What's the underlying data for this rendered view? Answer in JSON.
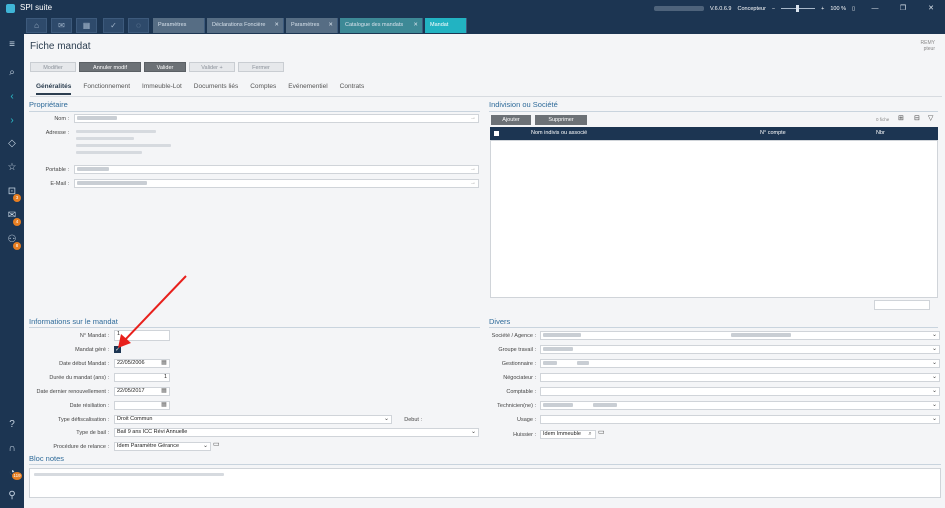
{
  "app": {
    "title": "SPI suite",
    "version": "V.6.0.6.9",
    "mode": "Concepteur",
    "zoom": "100 %"
  },
  "window_controls": [
    "—",
    "❐",
    "✕"
  ],
  "toolbar_icons": [
    "home-icon",
    "mail-icon",
    "calendar-icon",
    "check-icon",
    "bell-icon"
  ],
  "doc_tabs": [
    {
      "label": "Paramètres",
      "close": ""
    },
    {
      "label": "Déclarations Foncière",
      "close": "✕"
    },
    {
      "label": "Paramètres",
      "close": "✕"
    },
    {
      "label": "Catalogue des mandats",
      "close": "✕"
    },
    {
      "label": "Mandat",
      "close": ""
    }
  ],
  "sidebar_badges": [
    "3",
    "4",
    "8",
    "119"
  ],
  "page": {
    "title": "Fiche mandat",
    "user_line1": "REMY",
    "user_line2": "pteur"
  },
  "actions": {
    "modifier": "Modifier",
    "annuler": "Annuler modif",
    "valider": "Valider",
    "valider_plus": "Valider +",
    "fermer": "Fermer"
  },
  "tabs": [
    "Généralités",
    "Fonctionnement",
    "Immeuble-Lot",
    "Documents liés",
    "Comptes",
    "Evénementiel",
    "Contrats"
  ],
  "proprietaire": {
    "title": "Propriétaire",
    "nom_label": "Nom :",
    "adresse_label": "Adresse :",
    "portable_label": "Portable :",
    "email_label": "E-Mail :"
  },
  "indivision": {
    "title": "Indivision ou Société",
    "add": "Ajouter",
    "remove": "Supprimer",
    "count": "0 fiche",
    "columns": [
      "Nom indivis ou associé",
      "N° compte",
      "Nbr"
    ]
  },
  "mandat": {
    "title": "Informations sur le mandat",
    "numero_label": "N° Mandat :",
    "numero_value": "1",
    "gere_label": "Mandat géré :",
    "gere_checked": "✓",
    "debut_label": "Date début Mandat :",
    "debut_value": "22/05/2006",
    "duree_label": "Durée du mandat (ans) :",
    "duree_value": "1",
    "renouv_label": "Date dernier renouvellement :",
    "renouv_value": "22/05/2017",
    "resil_label": "Date résiliation :",
    "defisc_label": "Type défiscalisation :",
    "defisc_value": "Droit Commun",
    "defisc_debut_label": "Debut :",
    "bail_label": "Type de bail :",
    "bail_value": "Bail 9 ans ICC Révi Annuelle",
    "relance_label": "Procédure de relance :",
    "relance_value": "Idem Paramètre Gérance"
  },
  "divers": {
    "title": "Divers",
    "labels": [
      "Société / Agence :",
      "Groupe travail :",
      "Gestionnaire :",
      "Négociateur :",
      "Comptable :",
      "Technicien(ne) :",
      "Usage :"
    ],
    "huissier_label": "Huissier :",
    "huissier_value": "Idem Immeuble"
  },
  "notes": {
    "title": "Bloc notes"
  },
  "colors": {
    "navy": "#1c3552",
    "teal": "#22b3c2",
    "accent": "#e67e22",
    "arrow": "#e8201c"
  }
}
